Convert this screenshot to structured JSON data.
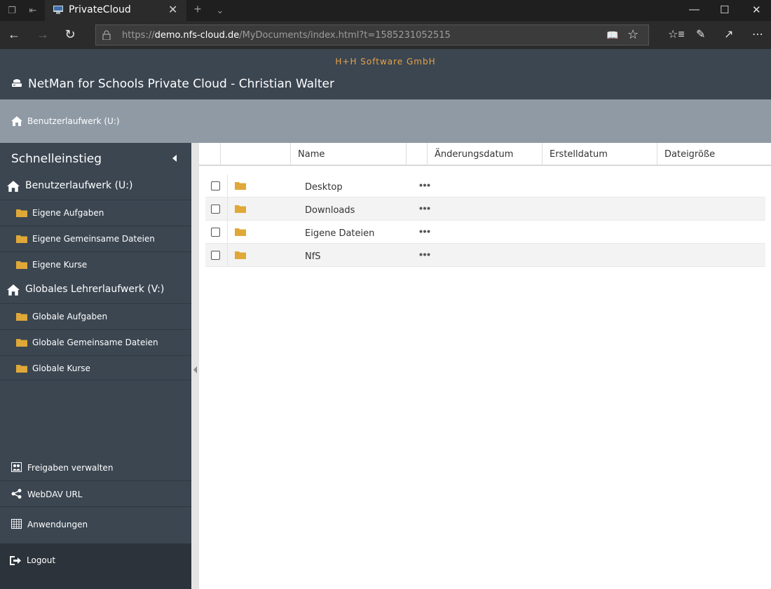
{
  "browser": {
    "tab_title": "PrivateCloud",
    "url_prefix": "https://",
    "url_host": "demo.nfs-cloud.de",
    "url_path": "/MyDocuments/index.html?t=1585231052515"
  },
  "header": {
    "company": "H+H Software GmbH",
    "title": "NetMan for Schools Private Cloud - Christian Walter"
  },
  "breadcrumb": {
    "current": "Benutzerlaufwerk (U:)"
  },
  "sidebar": {
    "heading": "Schnelleinstieg",
    "drives": [
      {
        "label": "Benutzerlaufwerk (U:)",
        "items": [
          "Eigene Aufgaben",
          "Eigene Gemeinsame Dateien",
          "Eigene Kurse"
        ]
      },
      {
        "label": "Globales Lehrerlaufwerk (V:)",
        "items": [
          "Globale Aufgaben",
          "Globale Gemeinsame Dateien",
          "Globale Kurse"
        ]
      }
    ],
    "bottom": [
      "Freigaben verwalten",
      "WebDAV URL",
      "Anwendungen"
    ],
    "logout": "Logout"
  },
  "table": {
    "columns": [
      "Name",
      "Änderungsdatum",
      "Erstelldatum",
      "Dateigröße"
    ],
    "rows": [
      {
        "name": "Desktop"
      },
      {
        "name": "Downloads"
      },
      {
        "name": "Eigene Dateien"
      },
      {
        "name": "NfS"
      }
    ]
  },
  "colors": {
    "header_bg": "#3b4651",
    "breadcrumb_bg": "#8f9aa5",
    "accent_orange": "#e7a34a",
    "folder": "#e0a838"
  }
}
